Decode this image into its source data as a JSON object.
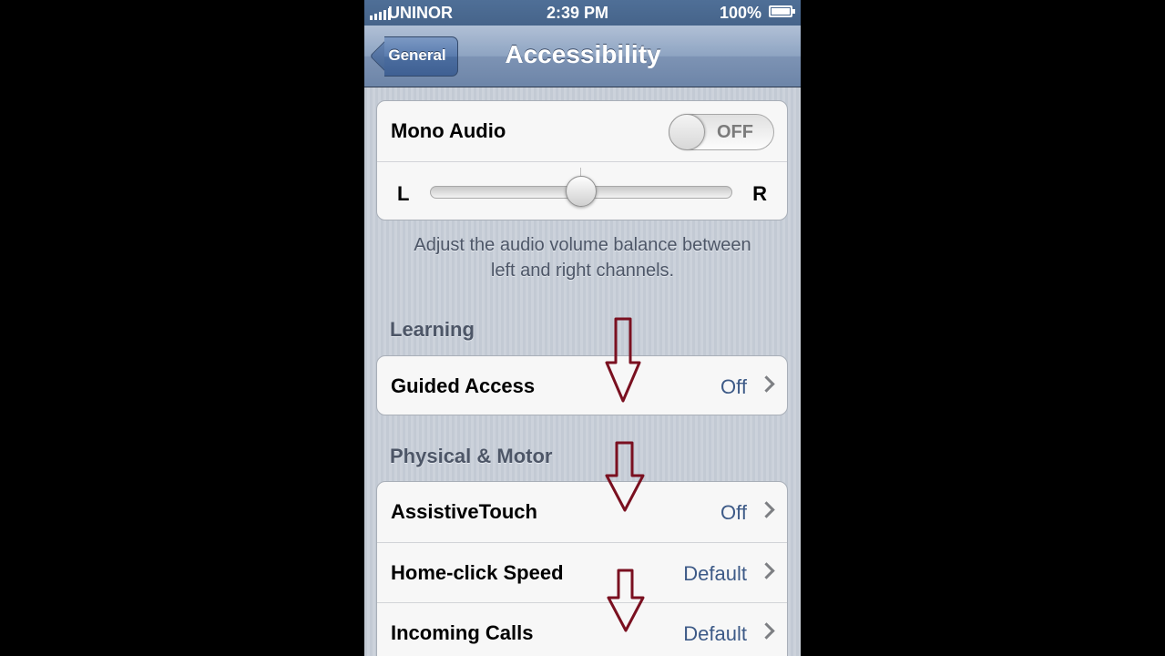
{
  "status_bar": {
    "carrier": "UNINOR",
    "time": "2:39 PM",
    "battery": "100%"
  },
  "nav": {
    "back_label": "General",
    "title": "Accessibility"
  },
  "hearing": {
    "mono_audio_label": "Mono Audio",
    "mono_audio_state": "OFF",
    "balance_left": "L",
    "balance_right": "R",
    "balance_value": 0.5,
    "footer_line1": "Adjust the audio volume balance between",
    "footer_line2": "left and right channels."
  },
  "learning": {
    "header": "Learning",
    "guided_access": {
      "label": "Guided Access",
      "value": "Off"
    }
  },
  "physical_motor": {
    "header": "Physical & Motor",
    "items": [
      {
        "label": "AssistiveTouch",
        "value": "Off"
      },
      {
        "label": "Home-click Speed",
        "value": "Default"
      },
      {
        "label": "Incoming Calls",
        "value": "Default"
      }
    ]
  },
  "annotation_color": "#7a1020"
}
